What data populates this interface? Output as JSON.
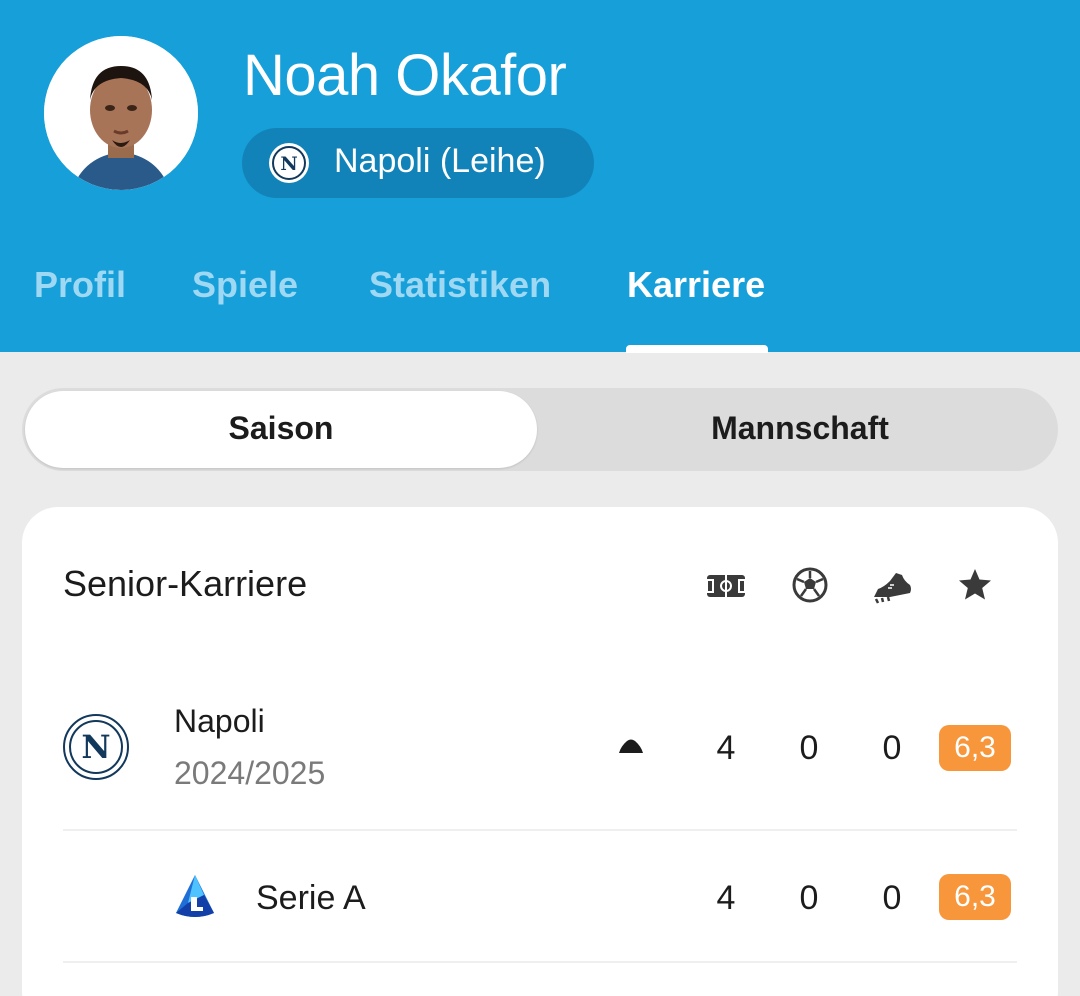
{
  "player": {
    "name": "Noah Okafor"
  },
  "club_badge": {
    "label": "Napoli (Leihe)",
    "logo_letter": "N"
  },
  "tabs": [
    {
      "label": "Profil",
      "active": false
    },
    {
      "label": "Spiele",
      "active": false
    },
    {
      "label": "Statistiken",
      "active": false
    },
    {
      "label": "Karriere",
      "active": true
    }
  ],
  "segment": {
    "options": [
      "Saison",
      "Mannschaft"
    ],
    "selected": "Saison"
  },
  "career": {
    "title": "Senior-Karriere",
    "stat_icons": [
      "pitch-icon",
      "ball-icon",
      "boot-icon",
      "star-icon"
    ],
    "rows": [
      {
        "club": "Napoli",
        "season": "2024/2025",
        "logo_letter": "N",
        "apps": "4",
        "goals": "0",
        "assists": "0",
        "rating": "6,3"
      }
    ],
    "sub_rows": [
      {
        "competition": "Serie A",
        "apps": "4",
        "goals": "0",
        "assists": "0",
        "rating": "6,3"
      }
    ]
  },
  "colors": {
    "header": "#169fd8",
    "pill": "#1283b8",
    "rating": "#f7963a",
    "tab_inactive": "#9fd8f3"
  }
}
